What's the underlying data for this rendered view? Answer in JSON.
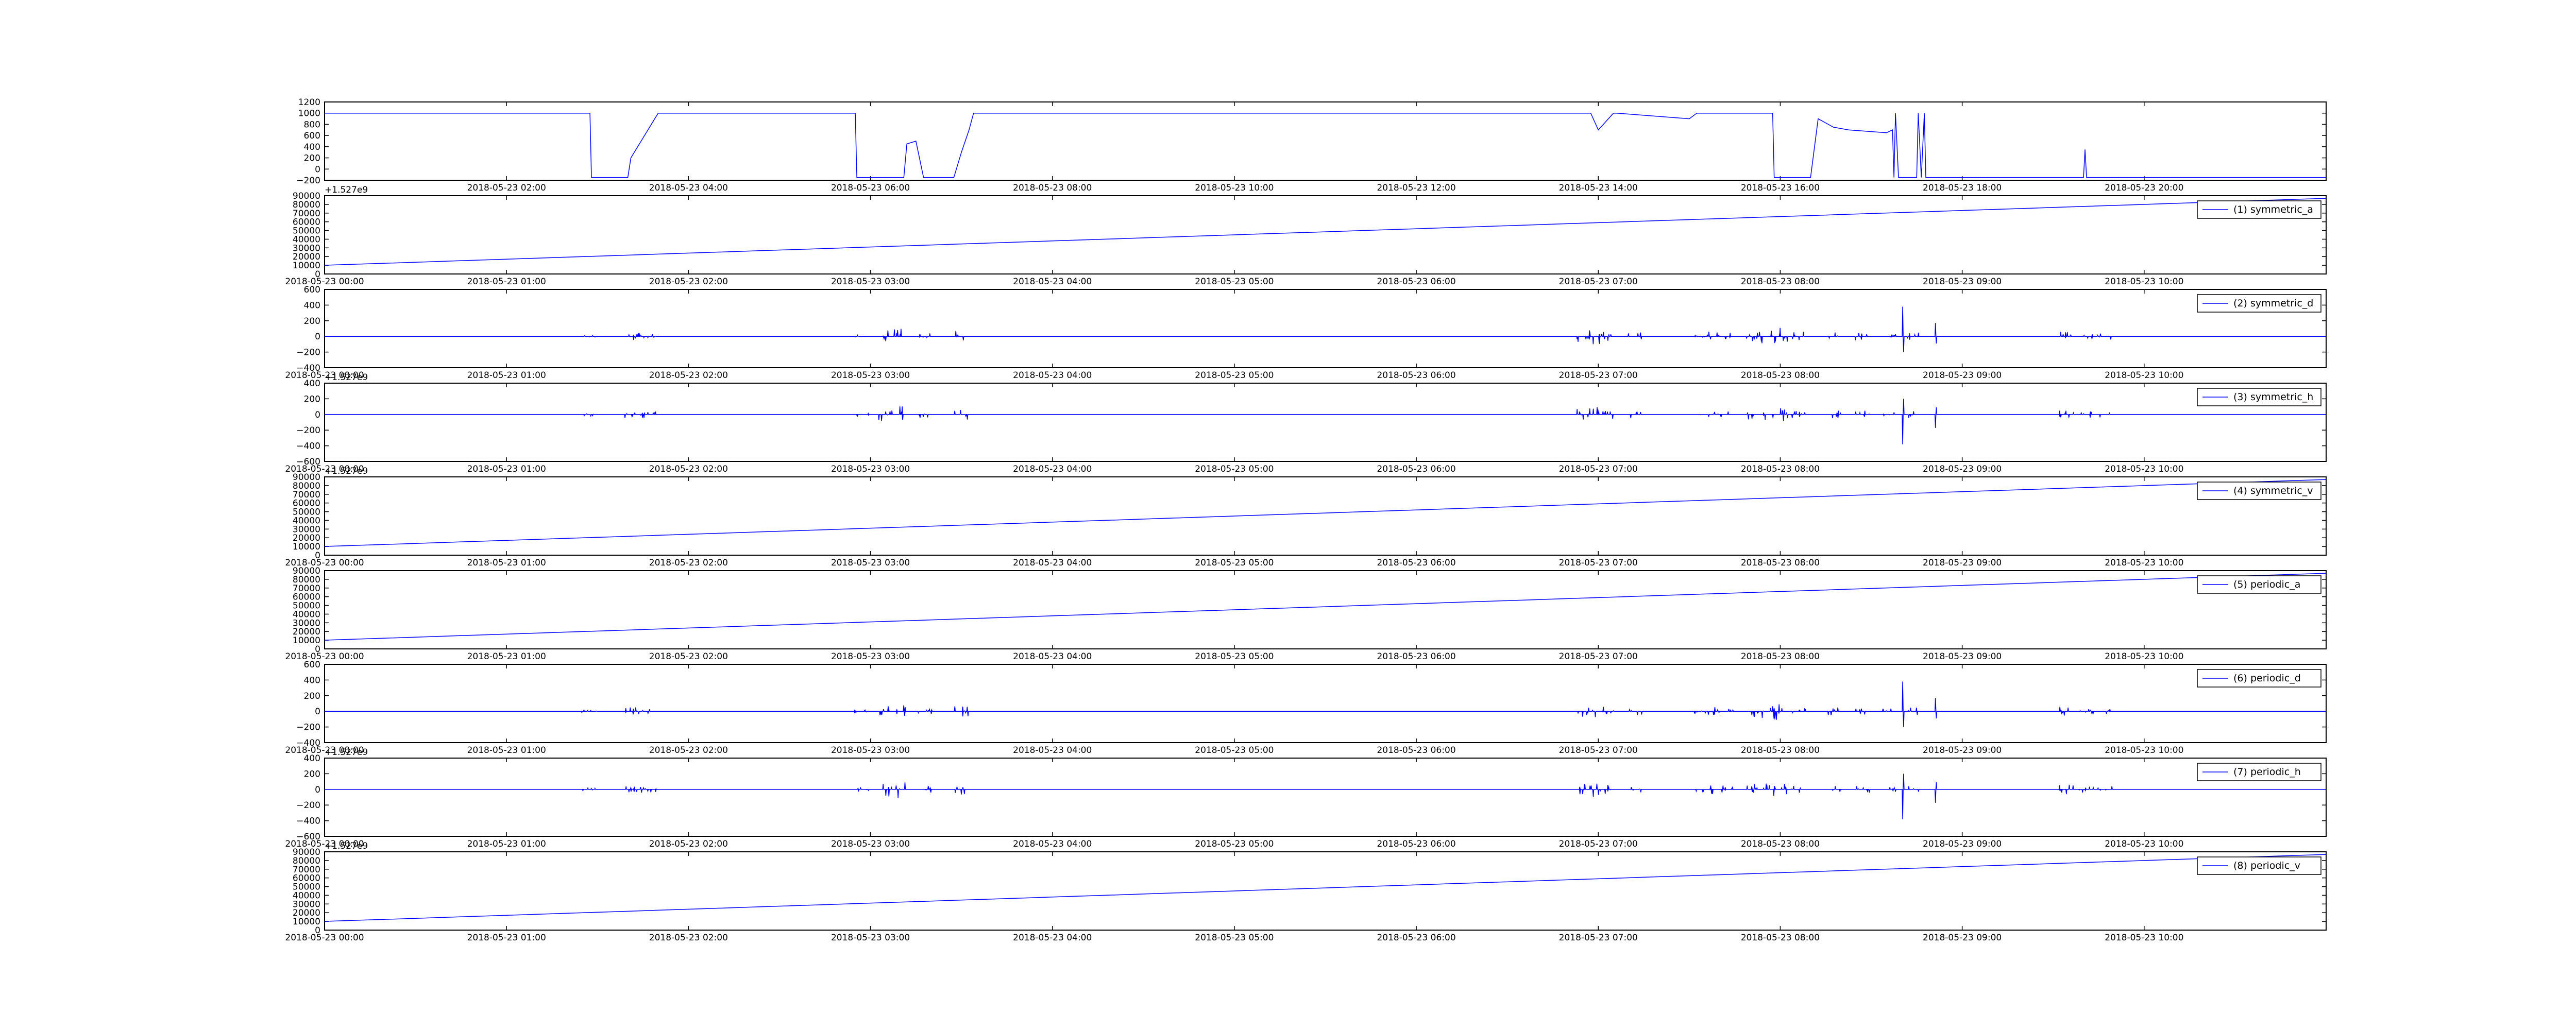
{
  "figure": {
    "background": "#ffffff",
    "line_color": "#0000ff"
  },
  "chart_data": [
    {
      "type": "line",
      "title": "",
      "xlabel": "",
      "ylabel": "",
      "x_tick_labels": [
        "2018-05-23 02:00",
        "2018-05-23 04:00",
        "2018-05-23 06:00",
        "2018-05-23 08:00",
        "2018-05-23 10:00",
        "2018-05-23 12:00",
        "2018-05-23 14:00",
        "2018-05-23 16:00",
        "2018-05-23 18:00",
        "2018-05-23 20:00"
      ],
      "xlim": [
        "2018-05-23 00:00",
        "2018-05-23 22:00"
      ],
      "ylim": [
        -200,
        1200
      ],
      "y_ticks": [
        -200,
        0,
        200,
        400,
        600,
        800,
        1000,
        1200
      ],
      "series": [
        {
          "x": [
            "2018-05-23 00:00",
            "2018-05-23 02:55",
            "2018-05-23 02:56",
            "2018-05-23 03:20",
            "2018-05-23 03:22",
            "2018-05-23 03:40",
            "2018-05-23 03:45",
            "2018-05-23 05:50",
            "2018-05-23 05:51",
            "2018-05-23 06:22",
            "2018-05-23 06:24",
            "2018-05-23 06:30",
            "2018-05-23 06:35",
            "2018-05-23 06:55",
            "2018-05-23 07:00",
            "2018-05-23 07:05",
            "2018-05-23 07:08",
            "2018-05-23 07:12",
            "2018-05-23 13:55",
            "2018-05-23 14:00",
            "2018-05-23 14:10",
            "2018-05-23 14:12",
            "2018-05-23 15:00",
            "2018-05-23 15:05",
            "2018-05-23 15:10",
            "2018-05-23 15:55",
            "2018-05-23 15:56",
            "2018-05-23 16:20",
            "2018-05-23 16:25",
            "2018-05-23 16:35",
            "2018-05-23 16:45",
            "2018-05-23 17:10",
            "2018-05-23 17:14",
            "2018-05-23 17:15",
            "2018-05-23 17:16",
            "2018-05-23 17:18",
            "2018-05-23 17:30",
            "2018-05-23 17:31",
            "2018-05-23 17:33",
            "2018-05-23 17:35",
            "2018-05-23 17:36",
            "2018-05-23 19:20",
            "2018-05-23 19:21",
            "2018-05-23 19:22",
            "2018-05-23 22:00"
          ],
          "values": [
            1000,
            1000,
            -150,
            -150,
            200,
            1000,
            1000,
            1000,
            -150,
            -150,
            450,
            500,
            -150,
            -150,
            300,
            700,
            1000,
            1000,
            1000,
            700,
            1000,
            1000,
            900,
            1000,
            1000,
            1000,
            -150,
            -150,
            900,
            750,
            700,
            650,
            700,
            -150,
            1000,
            -150,
            -150,
            1000,
            -150,
            1000,
            -150,
            -150,
            350,
            -150,
            -150
          ]
        }
      ]
    },
    {
      "type": "line",
      "offset_text": "+1.527e9",
      "xlim": [
        "2018-05-23 00:00",
        "2018-05-23 11:00"
      ],
      "x_tick_labels": [
        "2018-05-23 00:00",
        "2018-05-23 01:00",
        "2018-05-23 02:00",
        "2018-05-23 03:00",
        "2018-05-23 04:00",
        "2018-05-23 05:00",
        "2018-05-23 06:00",
        "2018-05-23 07:00",
        "2018-05-23 08:00",
        "2018-05-23 09:00",
        "2018-05-23 10:00"
      ],
      "ylim": [
        0,
        90000
      ],
      "y_ticks": [
        0,
        10000,
        20000,
        30000,
        40000,
        50000,
        60000,
        70000,
        80000,
        90000
      ],
      "legend": "(1) symmetric_a",
      "series": [
        {
          "name": "(1) symmetric_a",
          "x": [
            "2018-05-23 00:00",
            "2018-05-23 11:00"
          ],
          "values": [
            10000,
            87000
          ]
        }
      ]
    },
    {
      "type": "line",
      "xlim": [
        "2018-05-23 00:00",
        "2018-05-23 11:00"
      ],
      "x_tick_labels": [
        "2018-05-23 00:00",
        "2018-05-23 01:00",
        "2018-05-23 02:00",
        "2018-05-23 03:00",
        "2018-05-23 04:00",
        "2018-05-23 05:00",
        "2018-05-23 06:00",
        "2018-05-23 07:00",
        "2018-05-23 08:00",
        "2018-05-23 09:00",
        "2018-05-23 10:00"
      ],
      "ylim": [
        -400,
        600
      ],
      "y_ticks": [
        -400,
        -200,
        0,
        200,
        400,
        600
      ],
      "legend": "(2) symmetric_d",
      "series": [
        {
          "name": "(2) symmetric_d",
          "x": [
            "2018-05-23 00:00",
            "2018-05-23 11:00"
          ],
          "values": [
            0,
            0
          ]
        }
      ]
    },
    {
      "type": "line",
      "offset_text": "+1.527e9",
      "xlim": [
        "2018-05-23 00:00",
        "2018-05-23 11:00"
      ],
      "x_tick_labels": [
        "2018-05-23 00:00",
        "2018-05-23 01:00",
        "2018-05-23 02:00",
        "2018-05-23 03:00",
        "2018-05-23 04:00",
        "2018-05-23 05:00",
        "2018-05-23 06:00",
        "2018-05-23 07:00",
        "2018-05-23 08:00",
        "2018-05-23 09:00",
        "2018-05-23 10:00"
      ],
      "ylim": [
        -600,
        400
      ],
      "y_ticks": [
        -600,
        -400,
        -200,
        0,
        200,
        400
      ],
      "legend": "(3) symmetric_h",
      "series": [
        {
          "name": "(3) symmetric_h",
          "x": [
            "2018-05-23 00:00",
            "2018-05-23 11:00"
          ],
          "values": [
            0,
            0
          ]
        }
      ]
    },
    {
      "type": "line",
      "offset_text": "+1.527e9",
      "xlim": [
        "2018-05-23 00:00",
        "2018-05-23 11:00"
      ],
      "x_tick_labels": [
        "2018-05-23 00:00",
        "2018-05-23 01:00",
        "2018-05-23 02:00",
        "2018-05-23 03:00",
        "2018-05-23 04:00",
        "2018-05-23 05:00",
        "2018-05-23 06:00",
        "2018-05-23 07:00",
        "2018-05-23 08:00",
        "2018-05-23 09:00",
        "2018-05-23 10:00"
      ],
      "ylim": [
        0,
        90000
      ],
      "y_ticks": [
        0,
        10000,
        20000,
        30000,
        40000,
        50000,
        60000,
        70000,
        80000,
        90000
      ],
      "legend": "(4) symmetric_v",
      "series": [
        {
          "name": "(4) symmetric_v",
          "x": [
            "2018-05-23 00:00",
            "2018-05-23 11:00"
          ],
          "values": [
            10000,
            87000
          ]
        }
      ]
    },
    {
      "type": "line",
      "xlim": [
        "2018-05-23 00:00",
        "2018-05-23 11:00"
      ],
      "x_tick_labels": [
        "2018-05-23 00:00",
        "2018-05-23 01:00",
        "2018-05-23 02:00",
        "2018-05-23 03:00",
        "2018-05-23 04:00",
        "2018-05-23 05:00",
        "2018-05-23 06:00",
        "2018-05-23 07:00",
        "2018-05-23 08:00",
        "2018-05-23 09:00",
        "2018-05-23 10:00"
      ],
      "ylim": [
        0,
        90000
      ],
      "y_ticks": [
        0,
        10000,
        20000,
        30000,
        40000,
        50000,
        60000,
        70000,
        80000,
        90000
      ],
      "legend": "(5) periodic_a",
      "series": [
        {
          "name": "(5) periodic_a",
          "x": [
            "2018-05-23 00:00",
            "2018-05-23 11:00"
          ],
          "values": [
            10000,
            87000
          ]
        }
      ]
    },
    {
      "type": "line",
      "xlim": [
        "2018-05-23 00:00",
        "2018-05-23 11:00"
      ],
      "x_tick_labels": [
        "2018-05-23 00:00",
        "2018-05-23 01:00",
        "2018-05-23 02:00",
        "2018-05-23 03:00",
        "2018-05-23 04:00",
        "2018-05-23 05:00",
        "2018-05-23 06:00",
        "2018-05-23 07:00",
        "2018-05-23 08:00",
        "2018-05-23 09:00",
        "2018-05-23 10:00"
      ],
      "ylim": [
        -400,
        600
      ],
      "y_ticks": [
        -400,
        -200,
        0,
        200,
        400,
        600
      ],
      "legend": "(6) periodic_d",
      "series": [
        {
          "name": "(6) periodic_d",
          "x": [
            "2018-05-23 00:00",
            "2018-05-23 11:00"
          ],
          "values": [
            0,
            0
          ]
        }
      ]
    },
    {
      "type": "line",
      "offset_text": "+1.527e9",
      "xlim": [
        "2018-05-23 00:00",
        "2018-05-23 11:00"
      ],
      "x_tick_labels": [
        "2018-05-23 00:00",
        "2018-05-23 01:00",
        "2018-05-23 02:00",
        "2018-05-23 03:00",
        "2018-05-23 04:00",
        "2018-05-23 05:00",
        "2018-05-23 06:00",
        "2018-05-23 07:00",
        "2018-05-23 08:00",
        "2018-05-23 09:00",
        "2018-05-23 10:00"
      ],
      "ylim": [
        -600,
        400
      ],
      "y_ticks": [
        -600,
        -400,
        -200,
        0,
        200,
        400
      ],
      "legend": "(7) periodic_h",
      "series": [
        {
          "name": "(7) periodic_h",
          "x": [
            "2018-05-23 00:00",
            "2018-05-23 11:00"
          ],
          "values": [
            0,
            0
          ]
        }
      ]
    },
    {
      "type": "line",
      "offset_text": "+1.527e9",
      "xlim": [
        "2018-05-23 00:00",
        "2018-05-23 11:00"
      ],
      "x_tick_labels": [
        "2018-05-23 00:00",
        "2018-05-23 01:00",
        "2018-05-23 02:00",
        "2018-05-23 03:00",
        "2018-05-23 04:00",
        "2018-05-23 05:00",
        "2018-05-23 06:00",
        "2018-05-23 07:00",
        "2018-05-23 08:00",
        "2018-05-23 09:00",
        "2018-05-23 10:00"
      ],
      "ylim": [
        0,
        90000
      ],
      "y_ticks": [
        0,
        10000,
        20000,
        30000,
        40000,
        50000,
        60000,
        70000,
        80000,
        90000
      ],
      "legend": "(8) periodic_v",
      "series": [
        {
          "name": "(8) periodic_v",
          "x": [
            "2018-05-23 00:00",
            "2018-05-23 11:00"
          ],
          "values": [
            10000,
            87000
          ]
        }
      ]
    }
  ]
}
